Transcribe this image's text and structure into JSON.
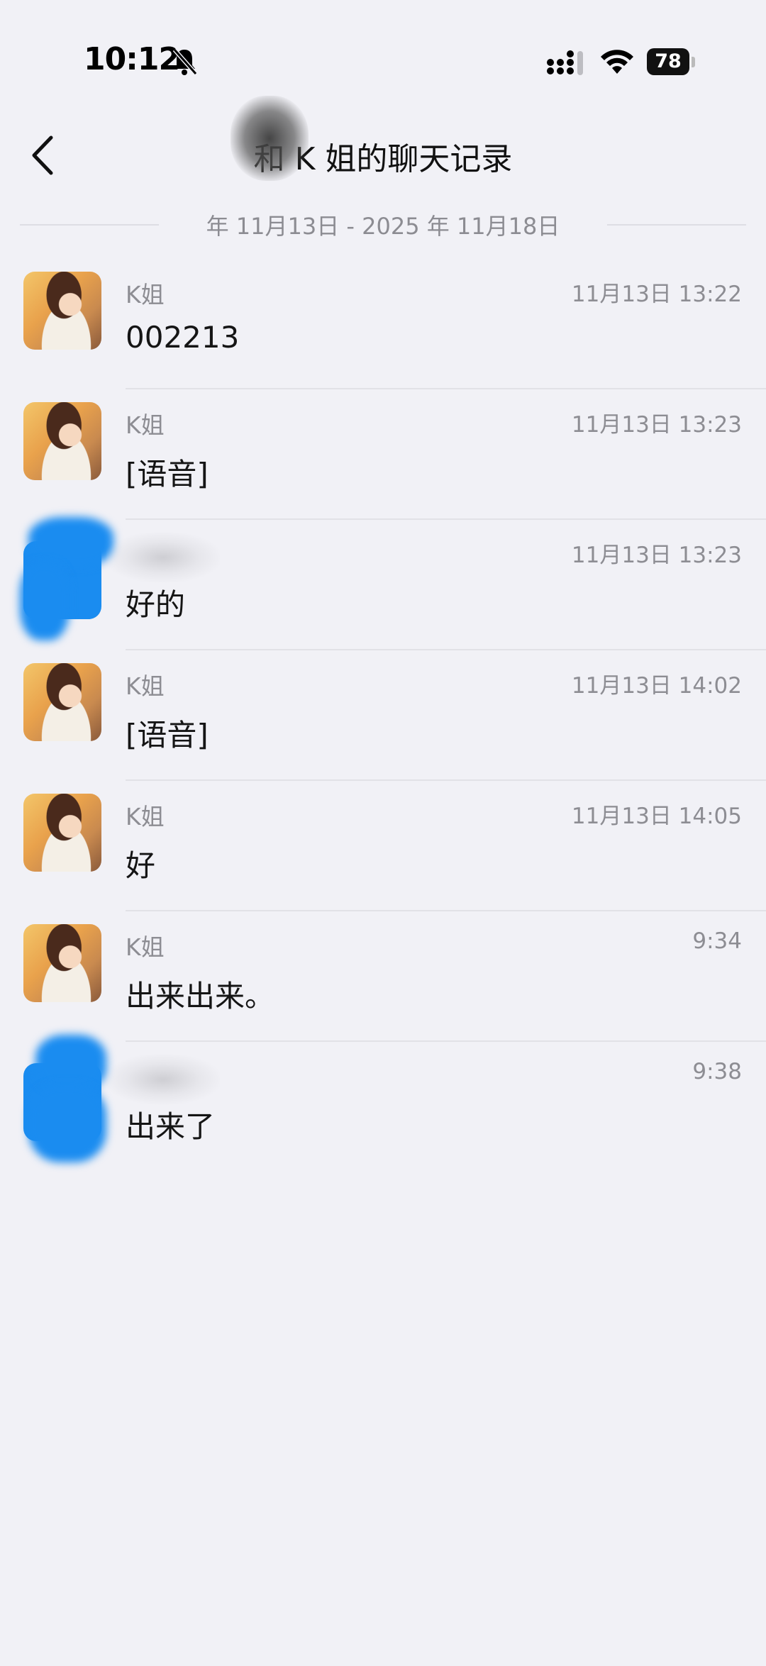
{
  "status_bar": {
    "time": "10:12",
    "battery": "78",
    "icons": [
      "bell-slash-icon",
      "cellular-signal-icon",
      "wifi-icon",
      "battery-icon"
    ]
  },
  "nav": {
    "back_icon": "chevron-left-icon",
    "title": "和 K 姐的聊天记录"
  },
  "date_range": "年 11月13日 - 2025 年 11月18日",
  "messages": [
    {
      "sender": "K姐",
      "time": "11月13日 13:22",
      "text": "002213",
      "avatar": "girl"
    },
    {
      "sender": "K姐",
      "time": "11月13日 13:23",
      "text": "[语音]",
      "avatar": "girl"
    },
    {
      "sender": "",
      "time": "11月13日 13:23",
      "text": "好的",
      "avatar": "blue"
    },
    {
      "sender": "K姐",
      "time": "11月13日 14:02",
      "text": "[语音]",
      "avatar": "girl"
    },
    {
      "sender": "K姐",
      "time": "11月13日 14:05",
      "text": "好",
      "avatar": "girl"
    },
    {
      "sender": "K姐",
      "time": "9:34",
      "text": "出来出来。",
      "avatar": "girl"
    },
    {
      "sender": "",
      "time": "9:38",
      "text": "出来了",
      "avatar": "blue"
    }
  ],
  "colors": {
    "background": "#f1f1f6",
    "secondary_text": "#8d8d93",
    "divider": "#e2e2e7",
    "blue_avatar": "#1a8cf0"
  }
}
